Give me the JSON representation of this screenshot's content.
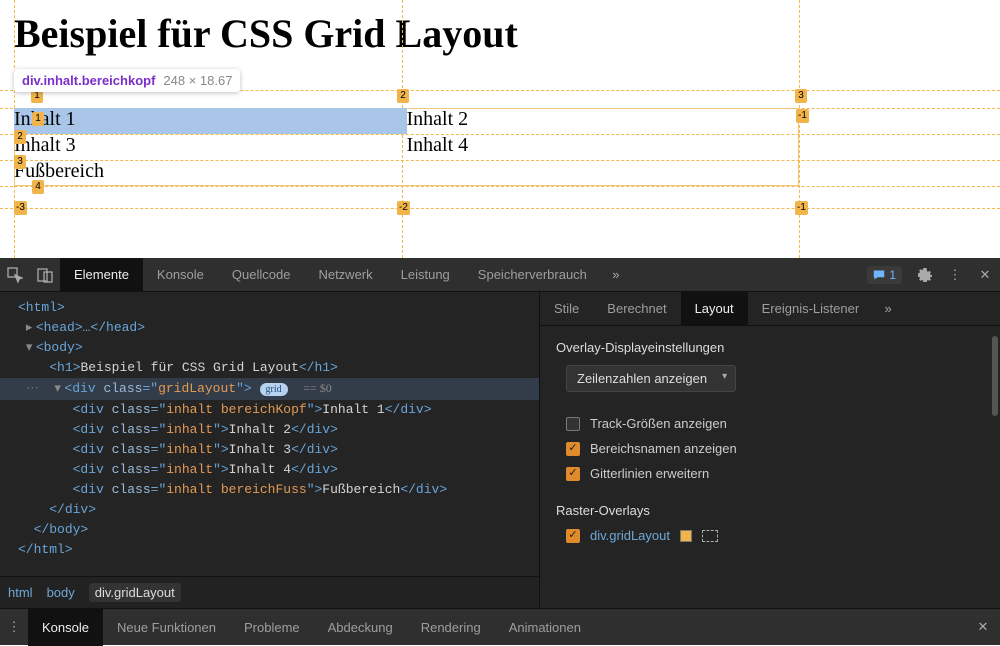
{
  "page": {
    "heading": "Beispiel für CSS Grid Layout",
    "tooltip_selector_tag": "div",
    "tooltip_selector_cls": ".inhalt.bereichkopf",
    "tooltip_dims": "248 × 18.67",
    "cells": {
      "c1": "Inhalt 1",
      "c2": "Inhalt 2",
      "c3": "Inhalt 3",
      "c4": "Inhalt 4",
      "footer": "Fußbereich"
    },
    "badges": {
      "top1": "1",
      "top2": "2",
      "top3": "3",
      "topR": "-1",
      "left1": "1",
      "left2": "2",
      "left3": "3",
      "left4": "4",
      "botL": "-3",
      "botM": "-2",
      "botR": "-1"
    }
  },
  "devtools": {
    "top_tabs": {
      "elements": "Elemente",
      "console": "Konsole",
      "sources": "Quellcode",
      "network": "Netzwerk",
      "performance": "Leistung",
      "memory": "Speicherverbrauch"
    },
    "msg_count": "1",
    "dom": {
      "html_open": "<html>",
      "head": "<head>…</head>",
      "body_open": "<body>",
      "h1_open": "<h1>",
      "h1_text": "Beispiel für CSS Grid Layout",
      "h1_close": "</h1>",
      "grid_open_tag": "div",
      "grid_attr_class": "class",
      "grid_attr_val": "gridLayout",
      "grid_pill": "grid",
      "grid_eq": "== $0",
      "cell1_val": "inhalt bereichKopf",
      "cell1_txt": "Inhalt 1",
      "cell2_val": "inhalt",
      "cell2_txt": "Inhalt 2",
      "cell3_val": "inhalt",
      "cell3_txt": "Inhalt 3",
      "cell4_val": "inhalt",
      "cell4_txt": "Inhalt 4",
      "cell5_val": "inhalt bereichFuss",
      "cell5_txt": "Fußbereich",
      "div_close": "</div>",
      "body_close": "</body>",
      "html_close": "</html>"
    },
    "breadcrumb": {
      "a": "html",
      "b": "body",
      "c": "div.gridLayout"
    },
    "side_tabs": {
      "styles": "Stile",
      "computed": "Berechnet",
      "layout": "Layout",
      "listeners": "Ereignis-Listener"
    },
    "layout": {
      "heading1": "Overlay-Displayeinstellungen",
      "dropdown": "Zeilenzahlen anzeigen",
      "opt_track": "Track-Größen anzeigen",
      "opt_area": "Bereichsnamen anzeigen",
      "opt_extend": "Gitterlinien erweitern",
      "heading2": "Raster-Overlays",
      "overlay_item": "div.gridLayout"
    },
    "drawer": {
      "console": "Konsole",
      "whatsnew": "Neue Funktionen",
      "issues": "Probleme",
      "coverage": "Abdeckung",
      "rendering": "Rendering",
      "animations": "Animationen"
    }
  }
}
